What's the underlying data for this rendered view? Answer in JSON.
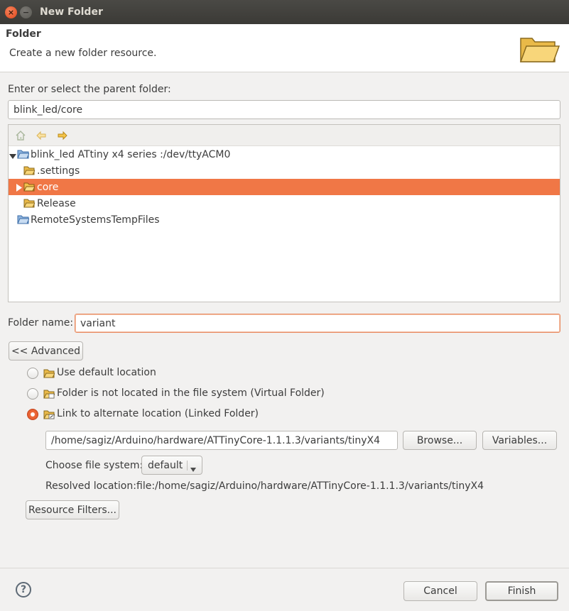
{
  "window": {
    "title": "New Folder"
  },
  "banner": {
    "title": "Folder",
    "subtitle": "Create a new folder resource."
  },
  "parent": {
    "label": "Enter or select the parent folder:",
    "value": "blink_led/core"
  },
  "tree": {
    "toolbar": [
      "home-icon",
      "back-arrow-icon",
      "forward-arrow-icon"
    ],
    "items": [
      {
        "label": "blink_led ATtiny x4 series :/dev/ttyACM0",
        "type": "project",
        "expanded": true,
        "selected": false
      },
      {
        "label": ".settings",
        "type": "folder",
        "selected": false
      },
      {
        "label": "core",
        "type": "folder",
        "selected": true,
        "expandable": true
      },
      {
        "label": "Release",
        "type": "folder",
        "selected": false
      },
      {
        "label": "RemoteSystemsTempFiles",
        "type": "project",
        "selected": false
      }
    ]
  },
  "folder_name": {
    "label": "Folder name:",
    "value": "variant"
  },
  "advanced_button": "<< Advanced",
  "options": [
    {
      "label": "Use default location",
      "mnemonic_index": 4,
      "checked": false
    },
    {
      "label": "Folder is not located in the file system (Virtual Folder)",
      "mnemonic_index": 51,
      "checked": false
    },
    {
      "label": "Link to alternate location (Linked Folder)",
      "mnemonic_index": 28,
      "checked": true
    }
  ],
  "link": {
    "path": "/home/sagiz/Arduino/hardware/ATTinyCore-1.1.1.3/variants/tinyX4",
    "browse_label": "Browse...",
    "variables_label": "Variables...",
    "filesystem_label": "Choose file system:",
    "filesystem_value": "default",
    "resolved_label": "Resolved location:",
    "resolved_value": "file:/home/sagiz/Arduino/hardware/ATTinyCore-1.1.1.3/variants/tinyX4"
  },
  "resource_filters_label": "Resource Filters...",
  "footer": {
    "cancel_label": "Cancel",
    "finish_label": "Finish"
  },
  "colors": {
    "accent": "#f07746",
    "titlebar": "#3c3b37",
    "folder": "#f5c55b"
  }
}
